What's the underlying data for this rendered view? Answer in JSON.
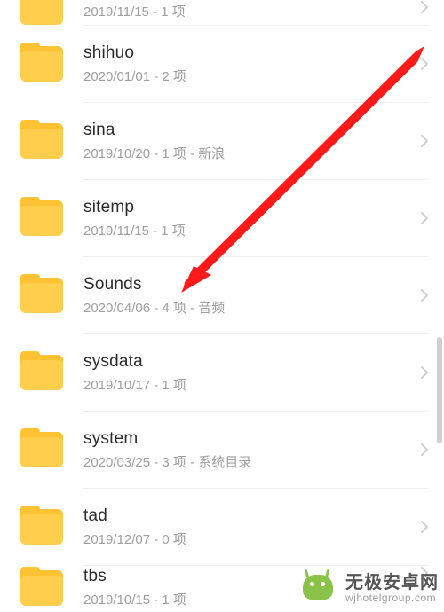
{
  "partial_top": {
    "meta": "2019/11/15 - 1 项"
  },
  "folders": [
    {
      "name": "shihuo",
      "meta": "2020/01/01 - 2 项"
    },
    {
      "name": "sina",
      "meta": "2019/10/20 - 1 项 - 新浪"
    },
    {
      "name": "sitemp",
      "meta": "2019/11/15 - 1 项"
    },
    {
      "name": "Sounds",
      "meta": "2020/04/06 - 4 项 - 音频"
    },
    {
      "name": "sysdata",
      "meta": "2019/10/17 - 1 项"
    },
    {
      "name": "system",
      "meta": "2020/03/25 - 3 项 - 系统目录"
    },
    {
      "name": "tad",
      "meta": "2019/12/07 - 0 项"
    }
  ],
  "partial_bottom": {
    "name": "tbs",
    "meta": "2019/10/15 - 1 项"
  },
  "watermark": {
    "line1": "无极安卓网",
    "line2": "wjhotelgroup.com"
  },
  "annotation": {
    "target": "Sounds"
  }
}
